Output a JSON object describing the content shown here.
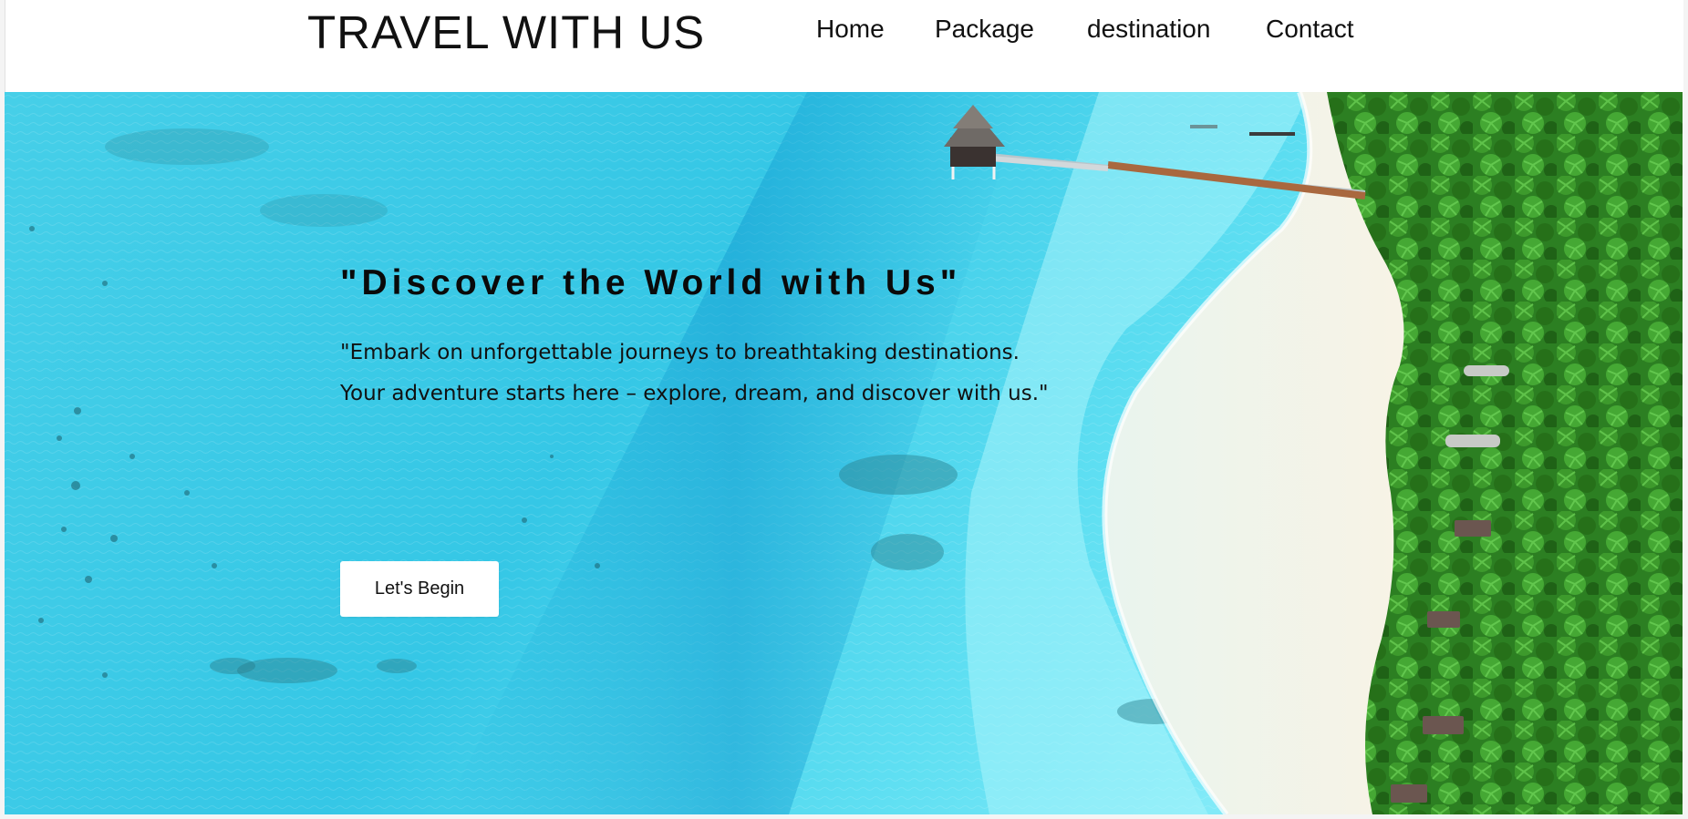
{
  "header": {
    "brand": "TRAVEL WITH US",
    "nav": [
      {
        "label": "Home"
      },
      {
        "label": "Package"
      },
      {
        "label": "destination"
      },
      {
        "label": "Contact"
      }
    ]
  },
  "hero": {
    "title": "\"Discover the World with Us\"",
    "lines": [
      "\"Embark on unforgettable journeys to breathtaking destinations.",
      "Your adventure starts here – explore, dream, and discover with us.\""
    ],
    "cta_label": "Let's Begin"
  },
  "colors": {
    "water_light": "#6fe6f7",
    "water_deep": "#1fb8dc",
    "sand": "#f4f1e6",
    "forest": "#2f8a26",
    "cta_bg": "#ffffff"
  }
}
